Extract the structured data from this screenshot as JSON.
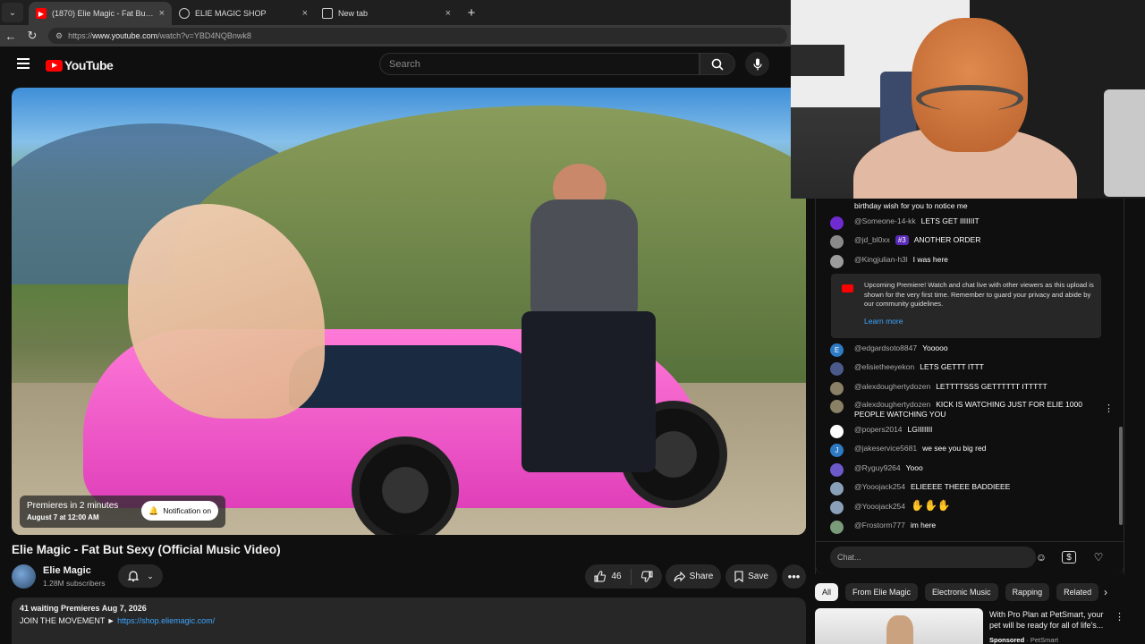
{
  "browser": {
    "tabs": [
      {
        "title": "(1870) Elie Magic - Fat But Sexy (O",
        "close": "×"
      },
      {
        "title": "ELIE MAGIC SHOP",
        "close": "×"
      },
      {
        "title": "New tab",
        "close": "×"
      }
    ],
    "new_tab": "+",
    "url_prefix": "https://",
    "url_host": "www.youtube.com",
    "url_path": "/watch?v=YBD4NQBnwk8"
  },
  "youtube": {
    "logo_text": "YouTube",
    "search_placeholder": "Search"
  },
  "video": {
    "premiere_line1": "Premieres in 2 minutes",
    "premiere_line2": "August 7 at 12:00 AM",
    "notification_label": "Notification on",
    "title": "Elie Magic - Fat But Sexy (Official Music Video)"
  },
  "channel": {
    "name": "Elie Magic",
    "subscribers": "1.28M subscribers"
  },
  "actions": {
    "likes": "46",
    "share": "Share",
    "save": "Save",
    "more": "•••"
  },
  "description": {
    "line1": "41 waiting  Premieres Aug 7, 2026",
    "line2_prefix": "JOIN THE MOVEMENT ► ",
    "link": "https://shop.eliemagic.com/"
  },
  "chat": {
    "messages": [
      {
        "author": "",
        "text": "birthday wish for you to notice me",
        "color": "#5a5a5a"
      },
      {
        "author": "@Someone-14-kk",
        "text": "LETS GET IIIIIIIT",
        "color": "#6f2ad0"
      },
      {
        "author": "@jd_bl0xx",
        "badge": "#3",
        "text": "ANOTHER ORDER",
        "color": "#8a8a8a"
      },
      {
        "author": "@Kingjulian-h3l",
        "text": "I was here",
        "color": "#9c9c9c"
      },
      {
        "author": "@edgardsoto8847",
        "text": "Yooooo",
        "color": "#2d7bc4",
        "initial": "E"
      },
      {
        "author": "@elisietheeyekon",
        "text": "LETS GETTT ITTT",
        "color": "#4b5a8a"
      },
      {
        "author": "@alexdoughertydozen",
        "text": "LETTTTSSS GETTTTTT ITTTTT",
        "color": "#8a8066"
      },
      {
        "author": "@alexdoughertydozen",
        "text": "KICK IS WATCHING JUST FOR ELIE 1000 PEOPLE WATCHING YOU",
        "color": "#8a8066"
      },
      {
        "author": "@popers2014",
        "text": "LGIIIIIII",
        "color": "#ffffff"
      },
      {
        "author": "@jakeservice5681",
        "text": "we see you big red",
        "color": "#2d7bc4",
        "initial": "J"
      },
      {
        "author": "@Ryguy9264",
        "text": "Yooo",
        "color": "#6c5ac8"
      },
      {
        "author": "@Yooojack254",
        "text": "ELIEEEE THEEE BADDIEEE",
        "color": "#8aa0b8"
      },
      {
        "author": "@Yooojack254",
        "text": "✋✋✋",
        "color": "#8aa0b8"
      },
      {
        "author": "@Frostorm777",
        "text": "im here",
        "color": "#7a9a7a"
      }
    ],
    "info_text": "Upcoming Premiere! Watch and chat live with other viewers as this upload is shown for the very first time. Remember to guard your privacy and abide by our community guidelines.",
    "learn_more": "Learn more",
    "input_placeholder": "Chat..."
  },
  "chips": [
    "All",
    "From Elie Magic",
    "Electronic Music",
    "Rapping",
    "Related"
  ],
  "ad": {
    "title": "With Pro Plan at PetSmart, your pet will be ready for all of life's...",
    "sponsored": "Sponsored",
    "advertiser": "· PetSmart"
  },
  "colors": {
    "youtube_red": "#ff0000",
    "link_blue": "#3ea6ff",
    "background": "#0f0f0f"
  }
}
